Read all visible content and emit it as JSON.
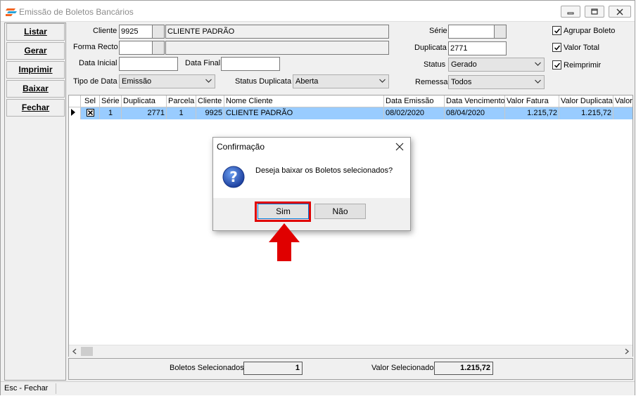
{
  "window": {
    "title": "Emissão de Boletos Bancários"
  },
  "sidebar": {
    "buttons": [
      {
        "label": "Listar"
      },
      {
        "label": "Gerar"
      },
      {
        "label": "Imprimir"
      },
      {
        "label": "Baixar"
      },
      {
        "label": "Fechar"
      }
    ]
  },
  "filters": {
    "cliente": {
      "label": "Cliente",
      "code": "9925",
      "name": "CLIENTE PADRÃO"
    },
    "forma_recto": {
      "label": "Forma Recto",
      "code": "",
      "name": ""
    },
    "data_inicial": {
      "label": "Data Inicial",
      "value": ""
    },
    "data_final": {
      "label": "Data Final",
      "value": ""
    },
    "tipo_data": {
      "label": "Tipo de Data",
      "value": "Emissão"
    },
    "status_duplicata": {
      "label": "Status Duplicata",
      "value": "Aberta"
    },
    "serie": {
      "label": "Série",
      "value": ""
    },
    "duplicata": {
      "label": "Duplicata",
      "value": "2771"
    },
    "status": {
      "label": "Status",
      "value": "Gerado"
    },
    "remessa": {
      "label": "Remessa",
      "value": "Todos"
    },
    "agrupar_boleto": {
      "label": "Agrupar Boleto",
      "checked": true
    },
    "valor_total": {
      "label": "Valor Total",
      "checked": true
    },
    "reimprimir": {
      "label": "Reimprimir",
      "checked": true
    }
  },
  "grid": {
    "columns": [
      "Sel",
      "Série",
      "Duplicata",
      "Parcela",
      "Cliente",
      "Nome Cliente",
      "Data Emissão",
      "Data Vencimento",
      "Valor Fatura",
      "Valor Duplicata",
      "Valor"
    ],
    "rows": [
      {
        "sel": true,
        "serie": "1",
        "duplicata": "2771",
        "parcela": "1",
        "cliente": "9925",
        "nome_cliente": "CLIENTE PADRÃO",
        "data_emissao": "08/02/2020",
        "data_vencimento": "08/04/2020",
        "valor_fatura": "1.215,72",
        "valor_duplicata": "1.215,72",
        "valor": ""
      }
    ]
  },
  "summary": {
    "boletos_label": "Boletos Selecionados",
    "boletos_value": "1",
    "valor_label": "Valor Selecionado",
    "valor_value": "1.215,72"
  },
  "statusbar": {
    "hint": "Esc - Fechar"
  },
  "dialog": {
    "title": "Confirmação",
    "message": "Deseja baixar os Boletos selecionados?",
    "yes_label": "Sim",
    "no_label": "Não"
  },
  "colors": {
    "highlight_row": "#99ccff",
    "annotation_red": "#e00000"
  }
}
